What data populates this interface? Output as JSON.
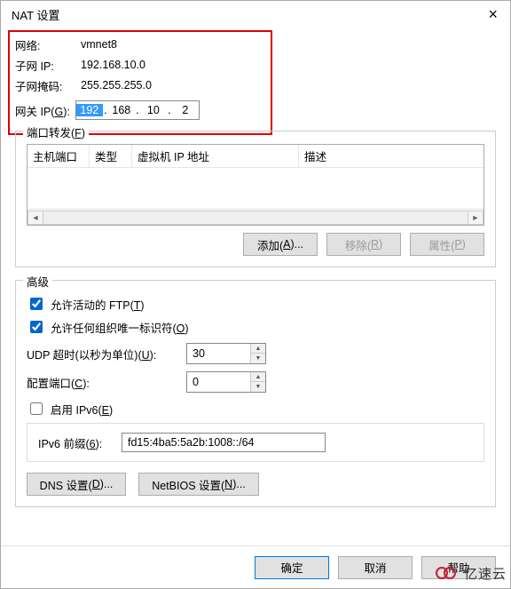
{
  "title": "NAT 设置",
  "network": {
    "label_network": "网络:",
    "value_network": "vmnet8",
    "label_subnet_ip": "子网 IP:",
    "value_subnet_ip": "192.168.10.0",
    "label_subnet_mask": "子网掩码:",
    "value_subnet_mask": "255.255.255.0",
    "label_gateway": "网关 IP(",
    "gateway_key": "G",
    "gateway_close": "):",
    "gateway_octets": [
      "192",
      "168",
      "10",
      "2"
    ]
  },
  "port_forwarding": {
    "legend_prefix": "端口转发(",
    "legend_key": "F",
    "legend_suffix": ")",
    "cols": [
      "主机端口",
      "类型",
      "虚拟机 IP 地址",
      "描述"
    ],
    "add_prefix": "添加(",
    "add_key": "A",
    "add_suffix": ")...",
    "remove_prefix": "移除(",
    "remove_key": "R",
    "remove_suffix": ")",
    "props_prefix": "属性(",
    "props_key": "P",
    "props_suffix": ")"
  },
  "advanced": {
    "legend": "高级",
    "ftp_prefix": "允许活动的 FTP(",
    "ftp_key": "T",
    "ftp_suffix": ")",
    "oui_prefix": "允许任何组织唯一标识符(",
    "oui_key": "O",
    "oui_suffix": ")",
    "udp_prefix": "UDP 超时(以秒为单位)(",
    "udp_key": "U",
    "udp_suffix": "):",
    "udp_value": "30",
    "cfgport_prefix": "配置端口(",
    "cfgport_key": "C",
    "cfgport_suffix": "):",
    "cfgport_value": "0",
    "ipv6_prefix": "启用 IPv6(",
    "ipv6_key": "E",
    "ipv6_suffix": ")",
    "ipv6prefix_prefix": "IPv6 前缀(",
    "ipv6prefix_key": "6",
    "ipv6prefix_suffix": "):",
    "ipv6prefix_value": "fd15:4ba5:5a2b:1008::/64",
    "dns_prefix": "DNS 设置(",
    "dns_key": "D",
    "dns_suffix": ")...",
    "netbios_prefix": "NetBIOS 设置(",
    "netbios_key": "N",
    "netbios_suffix": ")..."
  },
  "buttons": {
    "ok": "确定",
    "cancel": "取消",
    "help": "帮助"
  },
  "logo_text": "亿速云"
}
